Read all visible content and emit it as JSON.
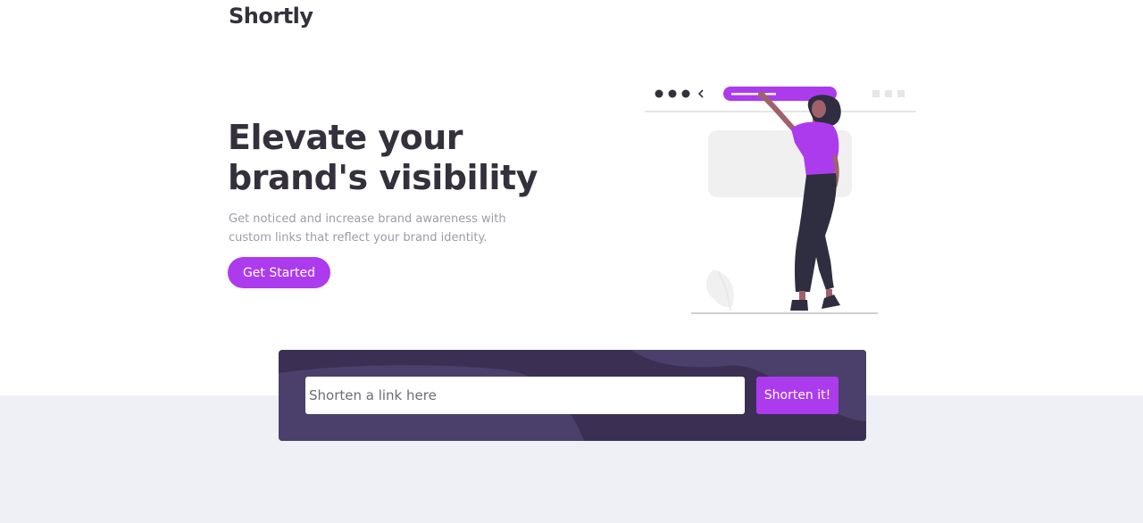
{
  "brand": {
    "logo_text": "Shortly"
  },
  "hero": {
    "title": "Elevate your brand's visibility",
    "subtitle": "Get noticed and increase brand awareness with custom links that reflect your brand identity.",
    "cta_label": "Get Started",
    "illustration_icon": "woman-at-browser-illustration"
  },
  "shorten": {
    "placeholder": "Shorten a link here",
    "value": "",
    "button_label": "Shorten it!"
  },
  "colors": {
    "primary": "#ac3bee",
    "dark_text": "#34313d",
    "muted_text": "#9e9aa7",
    "box_bg": "#3b3054",
    "bottom_section_bg": "#eff0f6"
  }
}
